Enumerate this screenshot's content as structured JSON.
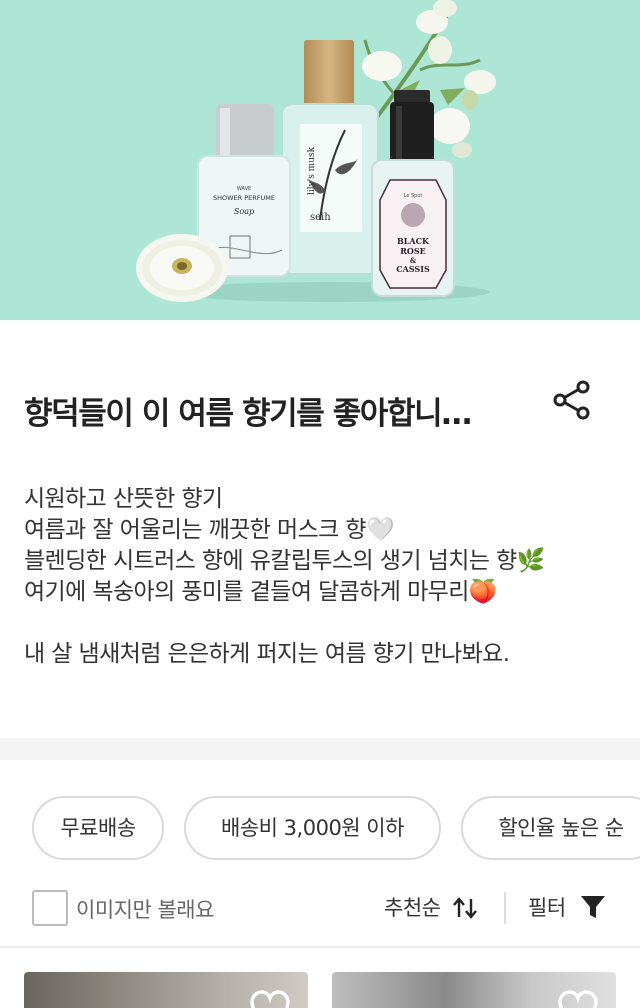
{
  "hero": {
    "bg_color": "#aee6d6",
    "label_left": "SHOWER PERFUME",
    "label_left_brand": "WAVE",
    "label_left_script": "Soap",
    "label_mid": "lily's musk",
    "label_mid_brand": "seih",
    "label_right_line1": "BLACK",
    "label_right_line2": "ROSE",
    "label_right_line3": "&",
    "label_right_line4": "CASSIS",
    "label_right_brand": "Le Spot"
  },
  "header": {
    "title": "향덕들이 이 여름 향기를 좋아합니…",
    "share_icon": "share-icon"
  },
  "description": {
    "lines": [
      "시원하고 산뜻한 향기",
      "여름과 잘 어울리는 깨끗한 머스크 향🤍",
      "블렌딩한 시트러스 향에 유칼립투스의 생기 넘치는 향🌿",
      "여기에 복숭아의 풍미를 곁들여 달콤하게 마무리🍑"
    ],
    "closing": "내 살 냄새처럼 은은하게 퍼지는 여름 향기 만나봐요."
  },
  "filters": {
    "chips": [
      "무료배송",
      "배송비 3,000원 이하",
      "할인율 높은 순"
    ]
  },
  "toolbar": {
    "image_only_label": "이미지만 볼래요",
    "image_only_checked": false,
    "sort_label": "추천순",
    "sort_icon": "sort-arrows-icon",
    "filter_label": "필터",
    "filter_icon": "funnel-icon"
  },
  "products": {
    "cards": [
      {
        "wishlist_icon": "heart-icon"
      },
      {
        "wishlist_icon": "heart-icon"
      }
    ]
  }
}
